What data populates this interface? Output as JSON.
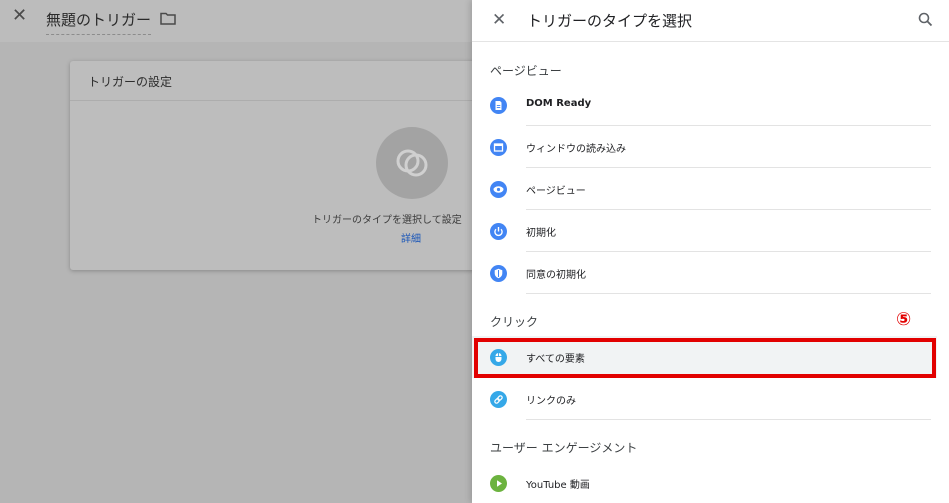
{
  "background": {
    "title": "無題のトリガー",
    "card_title": "トリガーの設定",
    "hint": "トリガーのタイプを選択して設定",
    "link": "詳細"
  },
  "panel": {
    "title": "トリガーのタイプを選択",
    "sections": [
      {
        "title": "ページビュー",
        "items": [
          {
            "label": "DOM Ready",
            "icon": "document-icon"
          },
          {
            "label": "ウィンドウの読み込み",
            "icon": "window-icon"
          },
          {
            "label": "ページビュー",
            "icon": "eye-icon"
          },
          {
            "label": "初期化",
            "icon": "power-icon"
          },
          {
            "label": "同意の初期化",
            "icon": "shield-icon"
          }
        ]
      },
      {
        "title": "クリック",
        "items": [
          {
            "label": "すべての要素",
            "icon": "mouse-icon"
          },
          {
            "label": "リンクのみ",
            "icon": "link-icon"
          }
        ]
      },
      {
        "title": "ユーザー エンゲージメント",
        "items": [
          {
            "label": "YouTube 動画",
            "icon": "play-icon"
          }
        ]
      }
    ]
  },
  "annotation": {
    "step_label": "⑤"
  },
  "colors": {
    "accent_blue": "#4285f4",
    "click_blue": "#35a8e8",
    "youtube_green": "#6cb33f",
    "highlight_red": "#e20000"
  }
}
